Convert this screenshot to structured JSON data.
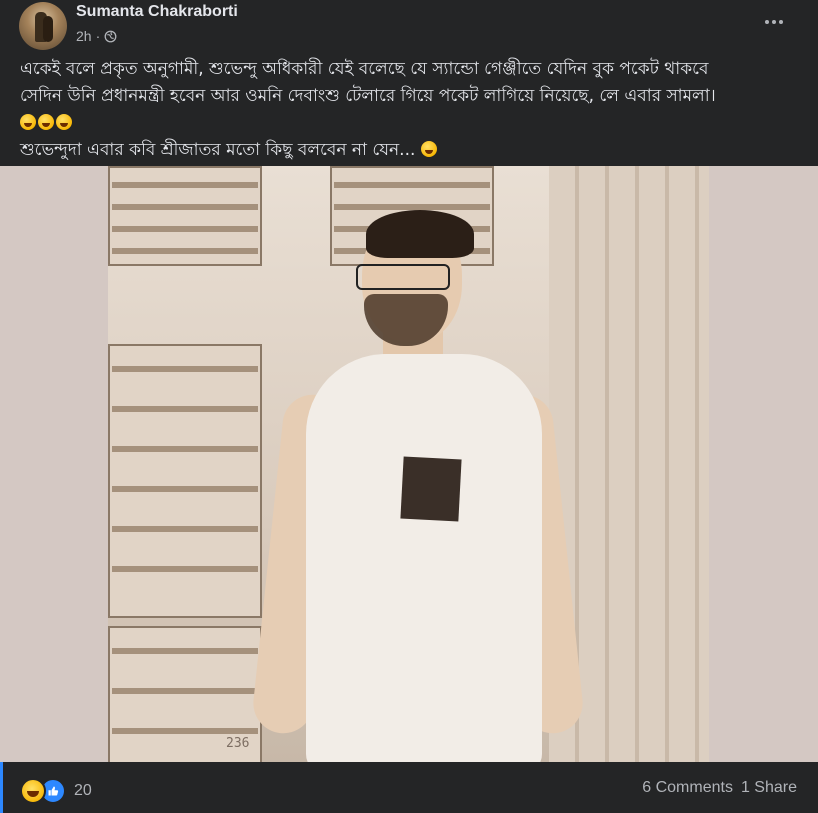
{
  "post": {
    "author": "Sumanta Chakraborti",
    "time": "2h",
    "privacy_icon": "globe-icon",
    "more_icon": "more-horizontal-icon",
    "text_line1": "একেই বলে প্রকৃত অনুগামী, শুভেন্দু অধিকারী যেই বলেছে যে স্যান্ডো গেঞ্জীতে যেদিন বুক পকেট থাকবে",
    "text_line2": "সেদিন উনি প্রধানমন্ত্রী হবেন আর ওমনি দেবাংশু টেলারে গিয়ে পকেট লাগিয়ে নিয়েছে, লে এবার সামলা।",
    "text_line3_emojis": "🤣🤣🤣",
    "text_line4": "শুভেন্দুদা এবার কবি শ্রীজাতর মতো কিছু বলবেন না যেন... ",
    "text_line4_emoji": "😜",
    "photo_watermark": "236"
  },
  "footer": {
    "reaction_icons": [
      "haha-icon",
      "like-icon"
    ],
    "reaction_count": "20",
    "comments": "6 Comments",
    "shares": "1 Share"
  },
  "colors": {
    "background": "#242526",
    "text_primary": "#e4e6eb",
    "text_secondary": "#b0b3b8",
    "accent": "#2d88ff"
  }
}
